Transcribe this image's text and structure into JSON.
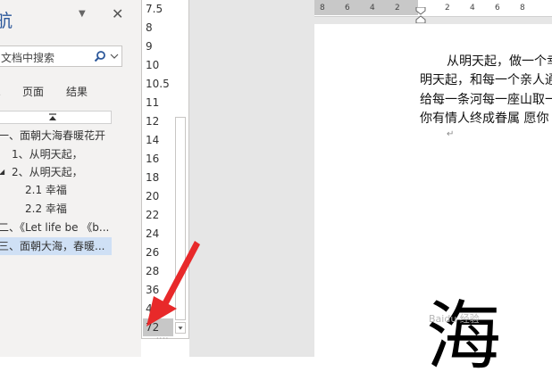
{
  "nav": {
    "title": "航",
    "search_text": "文档中搜索",
    "tabs": [
      "页面",
      "结果"
    ],
    "headings": [
      {
        "text": "一、面朝大海春暖花开",
        "level": 0
      },
      {
        "text": "1、从明天起，",
        "level": 1
      },
      {
        "text": "2、从明天起，",
        "level": 1
      },
      {
        "text": "2.1 幸福",
        "level": 2
      },
      {
        "text": "2.2 幸福",
        "level": 2
      },
      {
        "text": "二、《Let life be 《b...",
        "level": 0
      },
      {
        "text": "三、面朝大海，春暖...",
        "level": 0,
        "active": true
      }
    ]
  },
  "font_sizes": {
    "items": [
      "7.5",
      "8",
      "9",
      "10",
      "10.5",
      "11",
      "12",
      "14",
      "16",
      "18",
      "20",
      "22",
      "24",
      "26",
      "28",
      "36",
      "48",
      "72"
    ],
    "selected": "72"
  },
  "ruler": {
    "left_numbers": [
      "8",
      "6",
      "4",
      "2"
    ],
    "right_numbers": [
      "2",
      "4",
      "6",
      "8"
    ]
  },
  "document": {
    "lines": [
      "从明天起，做一个幸",
      "明天起，和每一个亲人通",
      "给每一条河每一座山取一",
      "你有情人终成眷属  愿你"
    ],
    "paragraph_mark": "↵",
    "big_char": "海",
    "watermark": "Baidu 经验"
  },
  "colors": {
    "nav_bg": "#f3f2f1",
    "nav_title": "#2b579a",
    "active_heading": "#cfe0f5",
    "selected_size": "#c7c7c7",
    "arrow": "#e8292a"
  }
}
